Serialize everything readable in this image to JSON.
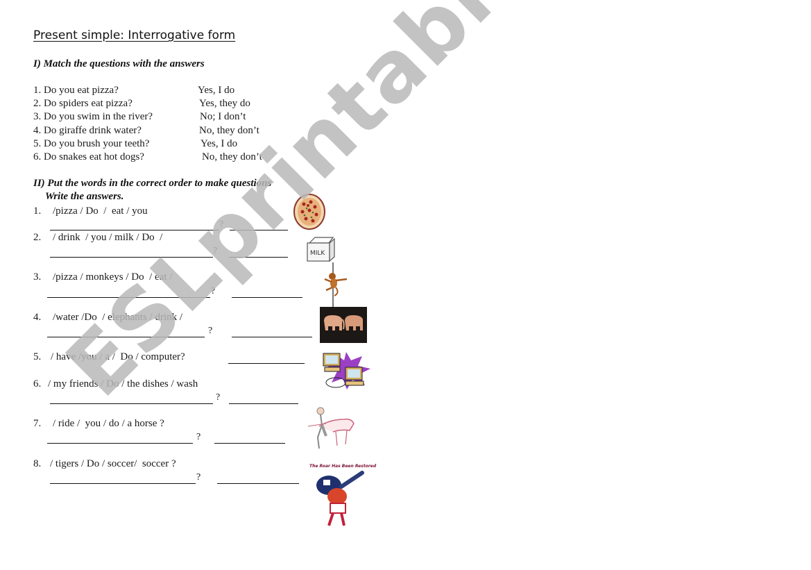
{
  "title": "Present simple: Interrogative form",
  "section1": {
    "heading": "I) Match the questions with the answers",
    "questions": [
      "1. Do you eat pizza?",
      "2. Do spiders eat pizza?",
      "3. Do you swim in the river?",
      "4. Do giraffe drink water?",
      "5. Do you brush your teeth?",
      "6. Do snakes eat hot dogs?"
    ],
    "answers": [
      "Yes, I do",
      "Yes, they do",
      "No; I don’t",
      "No, they don’t",
      "Yes, I do",
      "No, they don’t"
    ]
  },
  "section2": {
    "heading": "II) Put the words in the correct order to make questions",
    "subheading": "Write the answers.",
    "question_mark": "?",
    "items": [
      {
        "num": "1.",
        "words": "/pizza / Do  /  eat / you",
        "picture": "pizza-image"
      },
      {
        "num": "2.",
        "words": "/ drink  / you / milk / Do  /",
        "picture": "milk-carton-image"
      },
      {
        "num": "3.",
        "words": "/pizza / monkeys / Do  / eat /",
        "picture": "monkey-image"
      },
      {
        "num": "4.",
        "words": "/water /Do  / elephants / drink /",
        "picture": "elephants-image"
      },
      {
        "num": "5.",
        "words": "/ have /you / a /  Do / computer?",
        "picture": "computers-image"
      },
      {
        "num": "6.",
        "words": "/ my friends / Do / the dishes / wash",
        "picture": ""
      },
      {
        "num": "7.",
        "words": "/ ride /  you / do / a horse ?",
        "picture": "horse-rider-image"
      },
      {
        "num": "8.",
        "words": "/ tigers / Do / soccer/  soccer ?",
        "picture": "tiger-baseball-image"
      }
    ]
  },
  "tiger_caption": "The Roar Has Been Restored",
  "milk_label": "MILK",
  "watermark": "ESLprintables.com"
}
